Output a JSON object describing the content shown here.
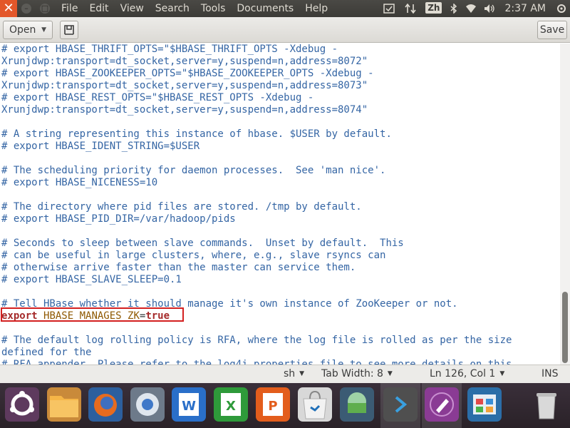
{
  "window": {
    "close_glyph": "✕",
    "min_glyph": "–",
    "max_glyph": "□"
  },
  "menubar": {
    "items": [
      "File",
      "Edit",
      "View",
      "Search",
      "Tools",
      "Documents",
      "Help"
    ]
  },
  "indicators": {
    "keyboard_layout": "Zh",
    "clock": "2:37 AM"
  },
  "toolbar": {
    "open_label": "Open",
    "save_label": "Save",
    "caret": "▼"
  },
  "editor": {
    "lines": [
      [
        [
          "comment",
          "# export HBASE_THRIFT_OPTS=\"$HBASE_THRIFT_OPTS -Xdebug -"
        ]
      ],
      [
        [
          "comment",
          "Xrunjdwp:transport=dt_socket,server=y,suspend=n,address=8072\""
        ]
      ],
      [
        [
          "comment",
          "# export HBASE_ZOOKEEPER_OPTS=\"$HBASE_ZOOKEEPER_OPTS -Xdebug -"
        ]
      ],
      [
        [
          "comment",
          "Xrunjdwp:transport=dt_socket,server=y,suspend=n,address=8073\""
        ]
      ],
      [
        [
          "comment",
          "# export HBASE_REST_OPTS=\"$HBASE_REST_OPTS -Xdebug -"
        ]
      ],
      [
        [
          "comment",
          "Xrunjdwp:transport=dt_socket,server=y,suspend=n,address=8074\""
        ]
      ],
      [],
      [
        [
          "comment",
          "# A string representing this instance of hbase. $USER by default."
        ]
      ],
      [
        [
          "comment",
          "# export HBASE_IDENT_STRING=$USER"
        ]
      ],
      [],
      [
        [
          "comment",
          "# The scheduling priority for daemon processes.  See 'man nice'."
        ]
      ],
      [
        [
          "comment",
          "# export HBASE_NICENESS=10"
        ]
      ],
      [],
      [
        [
          "comment",
          "# The directory where pid files are stored. /tmp by default."
        ]
      ],
      [
        [
          "comment",
          "# export HBASE_PID_DIR=/var/hadoop/pids"
        ]
      ],
      [],
      [
        [
          "comment",
          "# Seconds to sleep between slave commands.  Unset by default.  This"
        ]
      ],
      [
        [
          "comment",
          "# can be useful in large clusters, where, e.g., slave rsyncs can"
        ]
      ],
      [
        [
          "comment",
          "# otherwise arrive faster than the master can service them."
        ]
      ],
      [
        [
          "comment",
          "# export HBASE_SLAVE_SLEEP=0.1"
        ]
      ],
      [],
      [
        [
          "comment",
          "# Tell HBase whether it should manage it's own instance of ZooKeeper or not."
        ]
      ],
      [
        [
          "kw",
          "export"
        ],
        [
          "op",
          " "
        ],
        [
          "id",
          "HBASE_MANAGES_ZK"
        ],
        [
          "op",
          "="
        ],
        [
          "val",
          "true"
        ]
      ],
      [],
      [
        [
          "comment",
          "# The default log rolling policy is RFA, where the log file is rolled as per the size"
        ]
      ],
      [
        [
          "comment",
          "defined for the"
        ]
      ],
      [
        [
          "comment",
          "# RFA appender. Please refer to the log4j.properties file to see more details on this"
        ]
      ]
    ]
  },
  "statusbar": {
    "language": "sh",
    "tab_width": "Tab Width: 8",
    "position": "Ln 126, Col 1",
    "mode": "INS",
    "caret": "▼"
  },
  "dock": {
    "apps": [
      {
        "name": "ubuntu-dash",
        "color": "#5e3a5e"
      },
      {
        "name": "files",
        "color": "#f2a33a"
      },
      {
        "name": "firefox",
        "color": "#e66b1f"
      },
      {
        "name": "chromium",
        "color": "#4a7fc1"
      },
      {
        "name": "wps-writer",
        "color": "#2a6fc9"
      },
      {
        "name": "wps-spreadsheets",
        "color": "#2e9a3a"
      },
      {
        "name": "wps-presentation",
        "color": "#e35d1c"
      },
      {
        "name": "software-center",
        "color": "#e8e8e8"
      },
      {
        "name": "android-studio",
        "color": "#5fae4e"
      },
      {
        "name": "vscode",
        "color": "#4f4f4f"
      },
      {
        "name": "text-editor",
        "color": "#8a3b94"
      },
      {
        "name": "app-grid",
        "color": "#3a8fd6"
      },
      {
        "name": "trash",
        "color": "#9a9a9a"
      }
    ]
  }
}
